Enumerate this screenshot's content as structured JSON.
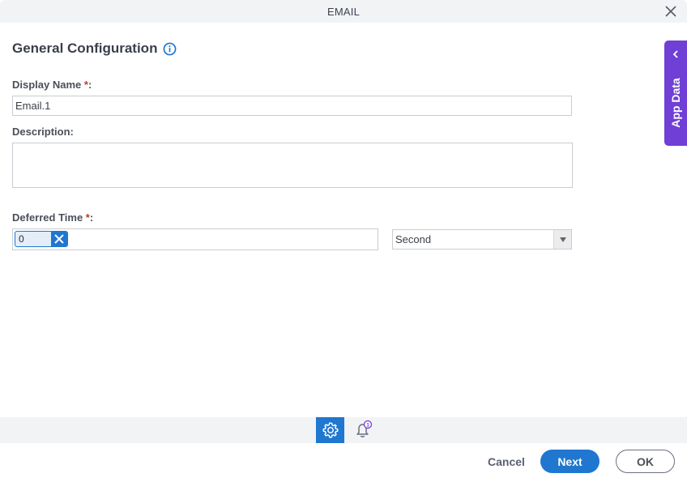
{
  "dialog": {
    "title": "EMAIL",
    "close_icon": "close-icon"
  },
  "section": {
    "title": "General Configuration",
    "info_icon": "info-icon"
  },
  "fields": {
    "display_name": {
      "label": "Display Name ",
      "required_mark": "*",
      "suffix": ":",
      "value": "Email.1"
    },
    "description": {
      "label": "Description:",
      "value": ""
    },
    "deferred_time": {
      "label": "Deferred Time ",
      "required_mark": "*",
      "suffix": ":",
      "value": "0",
      "unit": "Second"
    }
  },
  "side_panel": {
    "label": "App Data",
    "icon": "chevron-left-icon"
  },
  "tabs": [
    {
      "name": "settings",
      "icon": "gear-icon",
      "active": true
    },
    {
      "name": "notifications",
      "icon": "bell-icon",
      "badge": "1",
      "active": false
    }
  ],
  "footer": {
    "cancel_label": "Cancel",
    "next_label": "Next",
    "ok_label": "OK"
  },
  "colors": {
    "primary": "#1f77d0",
    "side_panel": "#6f3fd6",
    "required": "#c0392b",
    "badge": "#6f3fd6"
  }
}
